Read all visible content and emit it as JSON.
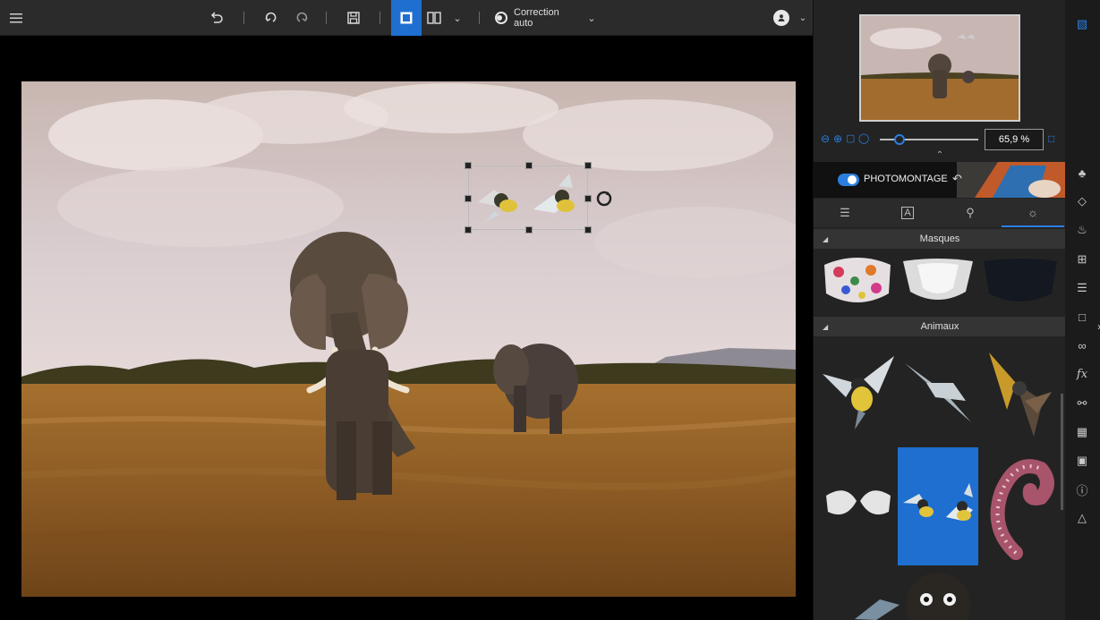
{
  "toolbar": {
    "menu_icon": "hamburger-icon",
    "undo_icon": "undo-icon",
    "undo2_icon": "undo-icon",
    "redo_icon": "redo-icon",
    "save_icon": "save-icon",
    "view_single_icon": "single-view-icon",
    "view_split_icon": "split-view-icon",
    "auto_correction_label": "Correction auto",
    "avatar_icon": "user-icon"
  },
  "navigator": {
    "zoom_value": "65,9 %",
    "zoom_level": 0.2
  },
  "photomontage": {
    "label": "PHOTOMONTAGE",
    "enabled": true
  },
  "tabs": [
    {
      "icon": "adjust-icon"
    },
    {
      "icon": "text-icon"
    },
    {
      "icon": "light-icon"
    },
    {
      "icon": "montage-icon",
      "active": true
    }
  ],
  "sections": {
    "masks_title": "Masques",
    "animals_title": "Animaux"
  },
  "right_tools": [
    "photomontage-icon",
    "eraser-icon",
    "clone-icon",
    "crop-icon",
    "sliders-icon",
    "selection-icon",
    "glasses-icon",
    "fx-icon",
    "color-icon",
    "texture-icon",
    "frame-icon",
    "info-icon",
    "flask-icon"
  ],
  "colors": {
    "accent": "#1e6fd0",
    "panel": "#232323",
    "toolbar": "#2b2b2b"
  }
}
